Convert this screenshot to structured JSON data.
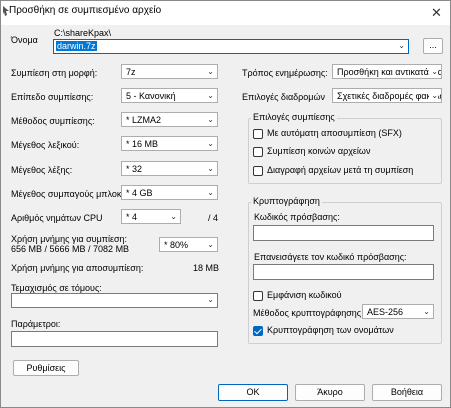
{
  "window": {
    "title": "Προσθήκη σε συμπιεσμένο αρχείο"
  },
  "name": {
    "label": "Όνομα",
    "path": "C:\\shareKpax\\",
    "value": "darwin.7z",
    "browse": "..."
  },
  "left": {
    "format": {
      "label": "Συμπίεση στη μορφή:",
      "value": "7z"
    },
    "level": {
      "label": "Επίπεδο συμπίεσης:",
      "value": "5 - Κανονική"
    },
    "method": {
      "label": "Μέθοδος συμπίεσης:",
      "value": "* LZMA2"
    },
    "dict": {
      "label": "Μέγεθος λεξικού:",
      "value": "* 16 MB"
    },
    "word": {
      "label": "Μέγεθος λέξης:",
      "value": "* 32"
    },
    "block": {
      "label": "Μέγεθος συμπαγούς μπλοκ:",
      "value": "* 4 GB"
    },
    "threads": {
      "label": "Αριθμός νημάτων CPU",
      "value": "* 4",
      "max": "/ 4"
    },
    "memcomp": {
      "label": "Χρήση μνήμης για συμπίεση:",
      "detail": "656 MB / 5666 MB / 7082 MB",
      "value": "* 80%"
    },
    "memdecomp": {
      "label": "Χρήση μνήμης για αποσυμπίεση:",
      "value": "18 MB"
    },
    "volumes": {
      "label": "Τεμαχισμός σε τόμους:",
      "value": ""
    },
    "params": {
      "label": "Παράμετροι:",
      "value": ""
    },
    "settings_button": "Ρυθμίσεις"
  },
  "right": {
    "update": {
      "label": "Τρόπος ενημέρωσης:",
      "value": "Προσθήκη και αντικατάσταση"
    },
    "pathmode": {
      "label": "Επιλογές διαδρομών",
      "value": "Σχετικές διαδρομές φακέλων"
    },
    "options": {
      "title": "Επιλογές συμπίεσης",
      "sfx": "Με αυτόματη αποσυμπίεση (SFX)",
      "shared": "Συμπίεση κοινών αρχείων",
      "delete": "Διαγραφή αρχείων μετά τη συμπίεση"
    },
    "encryption": {
      "title": "Κρυπτογράφηση",
      "password_label": "Κωδικός πρόσβασης:",
      "reenter_label": "Επανεισάγετε τον κωδικό πρόσβασης:",
      "show_password": "Εμφάνιση κωδικού",
      "method_label": "Μέθοδος κρυπτογράφησης",
      "method_value": "AES-256",
      "encrypt_names": "Κρυπτογράφηση των ονομάτων"
    }
  },
  "footer": {
    "ok": "OK",
    "cancel": "Άκυρο",
    "help": "Βοήθεια"
  },
  "state": {
    "sfx_checked": false,
    "shared_checked": false,
    "delete_checked": false,
    "show_password_checked": false,
    "encrypt_names_checked": true
  }
}
